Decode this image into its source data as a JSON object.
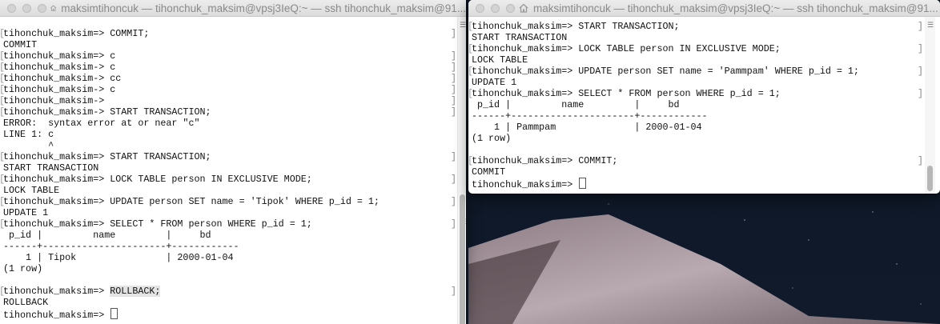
{
  "colors": {
    "desktop_bg": "#0b1220",
    "terminal_bg": "#ffffff",
    "text": "#111111",
    "highlight": "#e4e4e4"
  },
  "left_window": {
    "title": "maksimtihoncuk — tihonchuk_maksim@vpsj3IeQ:~ — ssh tihonchuk_maksim@91...",
    "icon": "home-icon",
    "lines": [
      "tihonchuk_maksim=> COMMIT;",
      "COMMIT",
      "tihonchuk_maksim=> c",
      "tihonchuk_maksim-> c",
      "tihonchuk_maksim-> cc",
      "tihonchuk_maksim-> c",
      "tihonchuk_maksim->",
      "tihonchuk_maksim-> START TRANSACTION;",
      "ERROR:  syntax error at or near \"c\"",
      "LINE 1: c",
      "        ^",
      "tihonchuk_maksim=> START TRANSACTION;",
      "START TRANSACTION",
      "tihonchuk_maksim=> LOCK TABLE person IN EXCLUSIVE MODE;",
      "LOCK TABLE",
      "tihonchuk_maksim=> UPDATE person SET name = 'Tipok' WHERE p_id = 1;",
      "UPDATE 1",
      "tihonchuk_maksim=> SELECT * FROM person WHERE p_id = 1;",
      " p_id |         name         |     bd",
      "------+----------------------+------------",
      "    1 | Tipok                | 2000-01-04",
      "(1 row)",
      "",
      "tihonchuk_maksim=> ",
      "ROLLBACK",
      "tihonchuk_maksim=> "
    ],
    "rollback_cmd": "ROLLBACK;"
  },
  "right_window": {
    "title": "maksimtihoncuk — tihonchuk_maksim@vpsj3IeQ:~ — ssh tihonchuk_maksim@91...",
    "icon": "home-icon",
    "lines": [
      "tihonchuk_maksim=> START TRANSACTION;",
      "START TRANSACTION",
      "tihonchuk_maksim=> LOCK TABLE person IN EXCLUSIVE MODE;",
      "LOCK TABLE",
      "tihonchuk_maksim=> UPDATE person SET name = 'Pammpam' WHERE p_id = 1;",
      "UPDATE 1",
      "tihonchuk_maksim=> SELECT * FROM person WHERE p_id = 1;",
      " p_id |         name         |     bd",
      "------+----------------------+------------",
      "    1 | Pammpam              | 2000-01-04",
      "(1 row)",
      "",
      "tihonchuk_maksim=> COMMIT;",
      "COMMIT",
      "tihonchuk_maksim=> "
    ]
  }
}
